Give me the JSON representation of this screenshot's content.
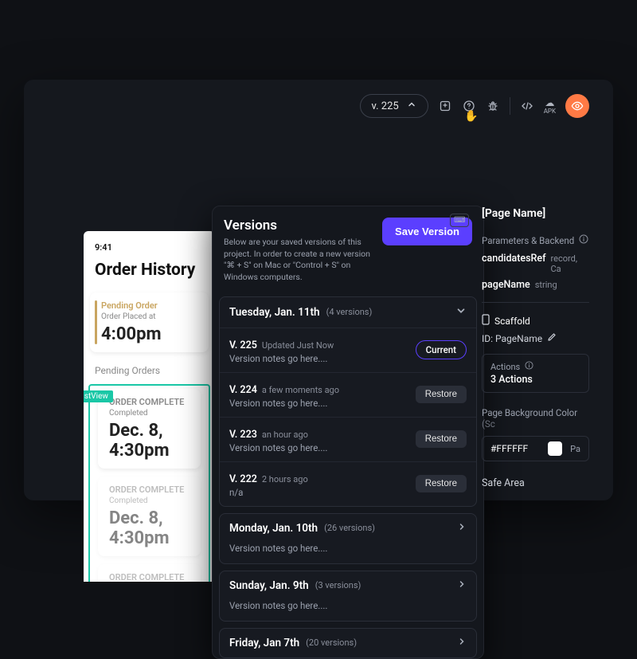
{
  "toolbar": {
    "version_chip": "v. 225"
  },
  "phone": {
    "status_time": "9:41",
    "title": "Order History",
    "pending_label": "Pending Order",
    "pending_sub": "Order Placed at",
    "pending_time": "4:00pm",
    "listview_tag": "listView",
    "section_header": "Pending Orders",
    "complete_label": "ORDER COMPLETE",
    "complete_sub": "Completed",
    "complete_date": "Dec. 8, 4:30pm"
  },
  "versions": {
    "title": "Versions",
    "subtitle": "Below are your saved versions of this project. In order to create a new version \"⌘ + S\" on Mac or \"Control + S\" on Windows computers.",
    "save_label": "Save Version",
    "days": [
      {
        "title": "Tuesday, Jan. 11th",
        "count": "(4 versions)",
        "expanded": true,
        "versions": [
          {
            "label": "V. 225",
            "time": "Updated Just Now",
            "notes": "Version notes go here....",
            "action": "Current"
          },
          {
            "label": "V. 224",
            "time": "a few moments ago",
            "notes": "Version notes go here....",
            "action": "Restore"
          },
          {
            "label": "V. 223",
            "time": "an hour ago",
            "notes": "Version notes go here....",
            "action": "Restore"
          },
          {
            "label": "V. 222",
            "time": "2 hours ago",
            "notes": "n/a",
            "action": "Restore"
          }
        ]
      },
      {
        "title": "Monday, Jan. 10th",
        "count": "(26 versions)",
        "note": "Version notes go here...."
      },
      {
        "title": "Sunday, Jan. 9th",
        "count": "(3 versions)",
        "note": "Version notes go here...."
      },
      {
        "title": "Friday, Jan 7th",
        "count": "(20 versions)",
        "note": ""
      }
    ]
  },
  "right": {
    "page_name": "[Page Name]",
    "params_label": "Parameters & Backend",
    "param1_key": "candidatesRef",
    "param1_val": "record, Ca",
    "param2_key": "pageName",
    "param2_val": "string",
    "scaffold_label": "Scaffold",
    "id_label": "ID: PageName",
    "actions_label": "Actions",
    "actions_count": "3 Actions",
    "bg_label": "Page Background Color",
    "bg_cut": "(Sc",
    "bg_hex": "#FFFFFF",
    "bg_pcut": "Pa",
    "safe_label": "Safe Area"
  }
}
